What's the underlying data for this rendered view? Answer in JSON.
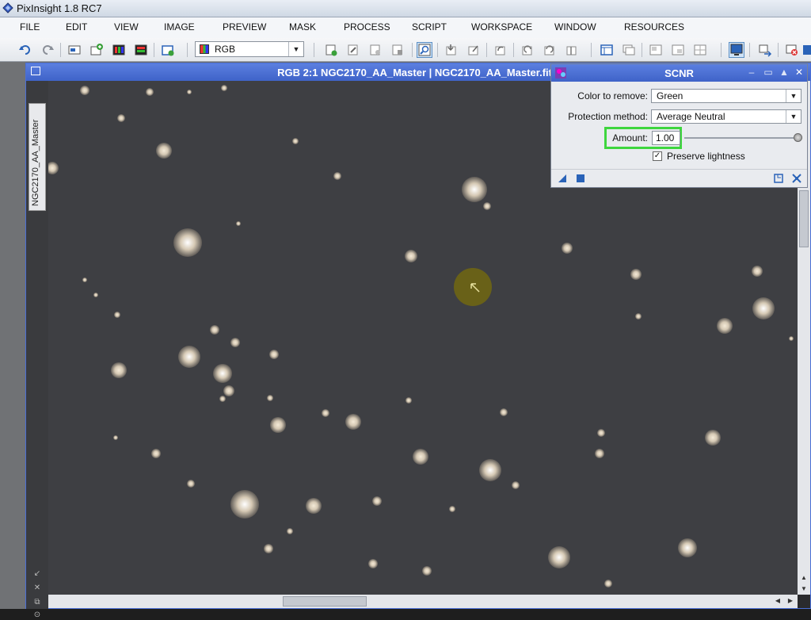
{
  "app": {
    "title": "PixInsight 1.8 RC7"
  },
  "menu": [
    "FILE",
    "EDIT",
    "VIEW",
    "IMAGE",
    "PREVIEW",
    "MASK",
    "PROCESS",
    "SCRIPT",
    "WORKSPACE",
    "WINDOW",
    "RESOURCES"
  ],
  "toolbar": {
    "channel_select": "RGB"
  },
  "image_window": {
    "title": "RGB 2:1 NGC2170_AA_Master | NGC2170_AA_Master.fit",
    "side_tab": "NGC2170_AA_Master"
  },
  "scnr": {
    "title": "SCNR",
    "color_to_remove_label": "Color to remove:",
    "color_to_remove": "Green",
    "protection_label": "Protection method:",
    "protection_method": "Average Neutral",
    "amount_label": "Amount:",
    "amount": "1.00",
    "amount_fraction": 1.0,
    "preserve_label": "Preserve lightness",
    "preserve_checked": true
  },
  "icons": [
    "undo-icon",
    "redo-icon",
    "new-image-icon",
    "zoom-icon",
    "execute-icon",
    "apply-global-icon"
  ],
  "colors": {
    "accent_title": "#4a6fd6",
    "highlight": "#3ed63e"
  }
}
